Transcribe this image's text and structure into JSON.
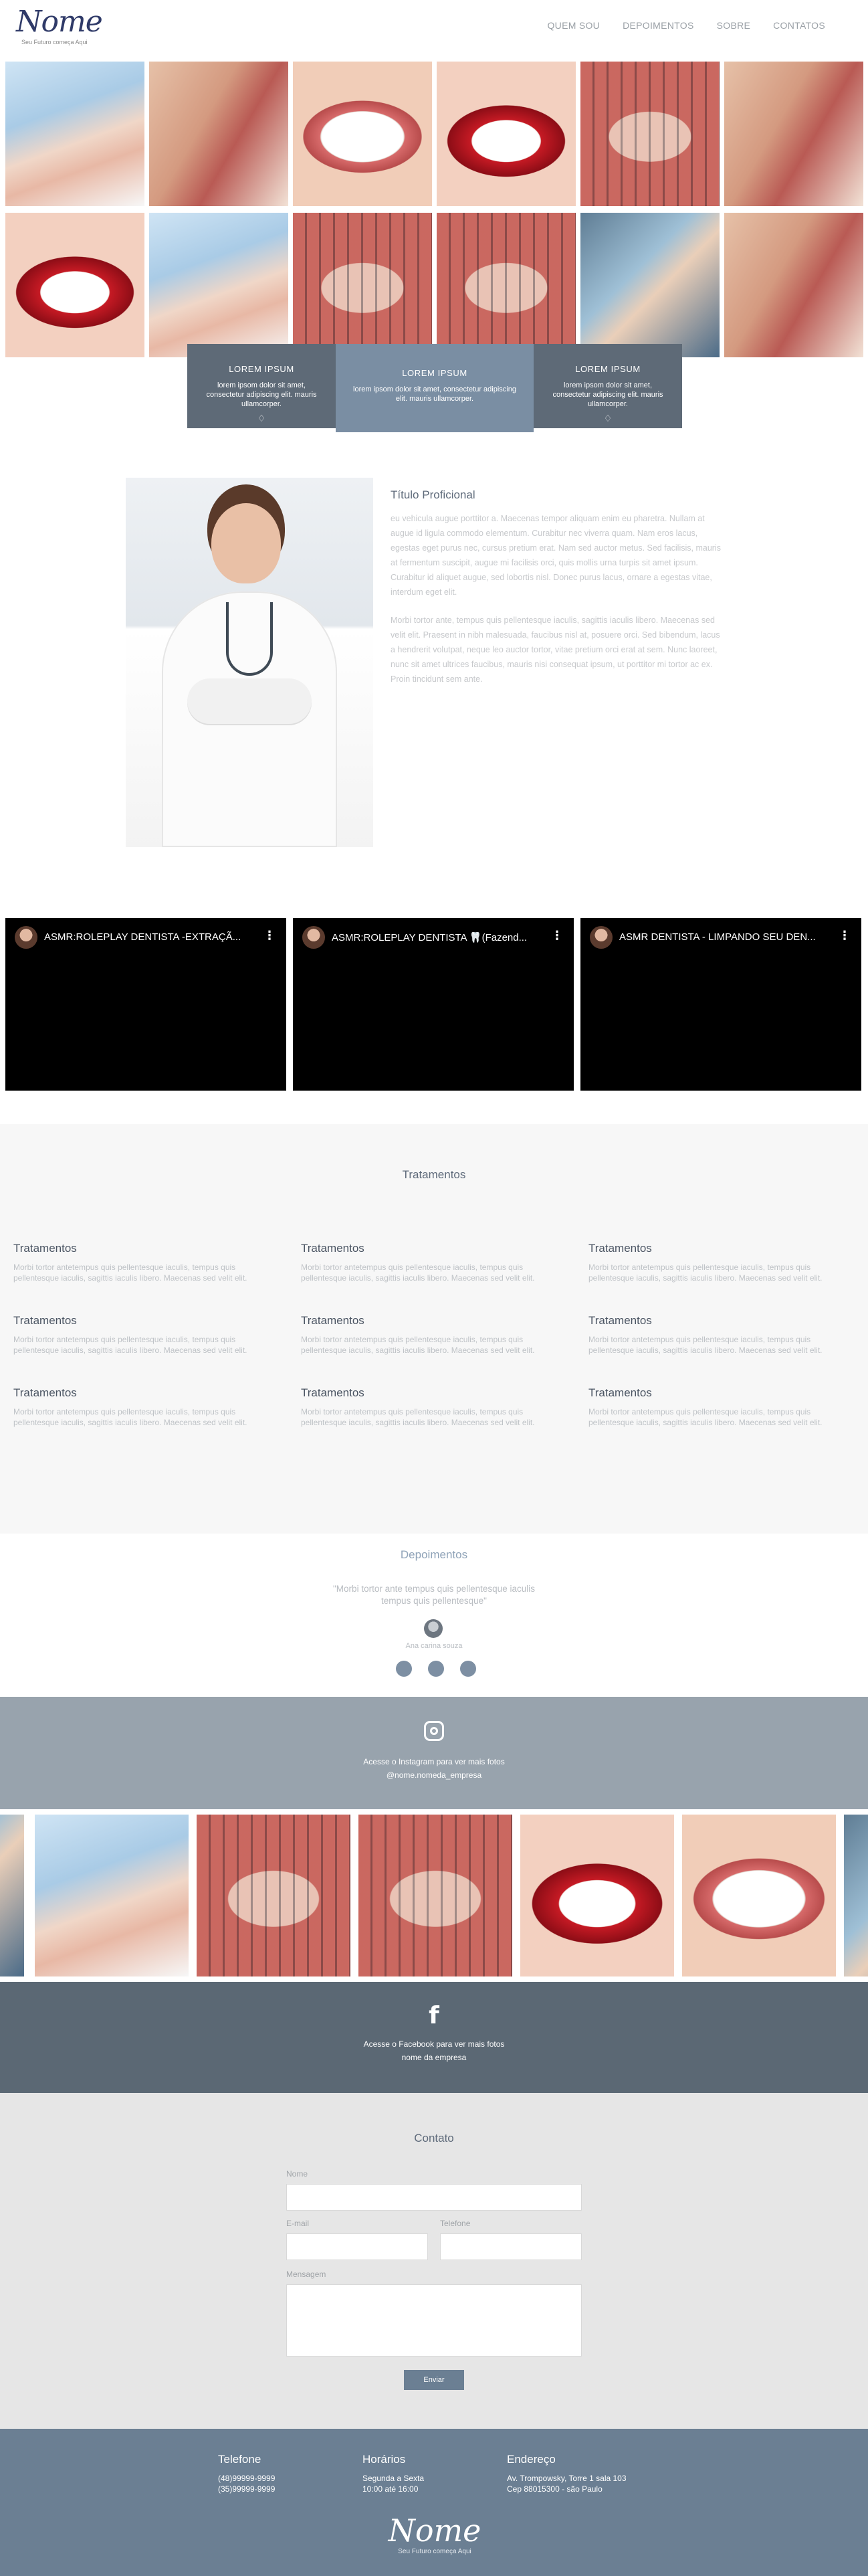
{
  "header": {
    "logo_text": "Nome",
    "logo_tagline": "Seu Futuro começa Aqui",
    "nav": [
      "QUEM SOU",
      "DEPOIMENTOS",
      "SOBRE",
      "CONTATOS"
    ]
  },
  "features": [
    {
      "title": "LOREM IPSUM",
      "text": "lorem ipsom dolor sit amet, consectetur adipiscing elit. mauris ullamcorper.",
      "icon": "tooth-icon"
    },
    {
      "title": "LOREM IPSUM",
      "text": "lorem ipsom dolor sit amet, consectetur adipiscing elit. mauris ullamcorper.",
      "icon": "none"
    },
    {
      "title": "LOREM IPSUM",
      "text": "lorem ipsom dolor sit amet, consectetur adipiscing elit. mauris ullamcorper.",
      "icon": "tooth-icon"
    }
  ],
  "about": {
    "title": "Título Proficional",
    "p1": "eu vehicula augue porttitor a. Maecenas tempor aliquam enim eu pharetra. Nullam at augue id ligula commodo elementum. Curabitur nec viverra quam. Nam eros lacus, egestas eget purus nec, cursus pretium erat. Nam sed auctor metus. Sed facilisis, mauris at fermentum suscipit, augue mi facilisis orci, quis mollis urna turpis sit amet ipsum. Curabitur id aliquet augue, sed lobortis nisl. Donec purus lacus, ornare a egestas vitae, interdum eget elit.",
    "p2": "Morbi tortor ante, tempus quis pellentesque iaculis, sagittis iaculis libero. Maecenas sed velit elit. Praesent in nibh malesuada, faucibus nisl at, posuere orci. Sed bibendum, lacus a hendrerit volutpat, neque leo auctor tortor, vitae pretium orci erat at sem. Nunc laoreet, nunc sit amet ultrices faucibus, mauris nisi consequat ipsum, ut porttitor mi tortor ac ex. Proin tincidunt sem ante."
  },
  "videos": [
    {
      "title": "ASMR:ROLEPLAY DENTISTA -EXTRAÇÃ...",
      "menu": "⋮"
    },
    {
      "title": "ASMR:ROLEPLAY DENTISTA 🦷(Fazend...",
      "menu": "⋮"
    },
    {
      "title": "ASMR DENTISTA - LIMPANDO SEU DEN...",
      "menu": "⋮"
    }
  ],
  "treatments": {
    "heading": "Tratamentos",
    "items": [
      {
        "title": "Tratamentos",
        "text": "Morbi tortor antetempus quis pellentesque iaculis, tempus quis pellentesque iaculis, sagittis iaculis libero. Maecenas sed velit elit."
      },
      {
        "title": "Tratamentos",
        "text": "Morbi tortor antetempus quis pellentesque iaculis, tempus quis pellentesque iaculis, sagittis iaculis libero. Maecenas sed velit elit."
      },
      {
        "title": "Tratamentos",
        "text": "Morbi tortor antetempus quis pellentesque iaculis, tempus quis pellentesque iaculis, sagittis iaculis libero. Maecenas sed velit elit."
      },
      {
        "title": "Tratamentos",
        "text": "Morbi tortor antetempus quis pellentesque iaculis, tempus quis pellentesque iaculis, sagittis iaculis libero. Maecenas sed velit elit."
      },
      {
        "title": "Tratamentos",
        "text": "Morbi tortor antetempus quis pellentesque iaculis, tempus quis pellentesque iaculis, sagittis iaculis libero. Maecenas sed velit elit."
      },
      {
        "title": "Tratamentos",
        "text": "Morbi tortor antetempus quis pellentesque iaculis, tempus quis pellentesque iaculis, sagittis iaculis libero. Maecenas sed velit elit."
      },
      {
        "title": "Tratamentos",
        "text": "Morbi tortor antetempus quis pellentesque iaculis, tempus quis pellentesque iaculis, sagittis iaculis libero. Maecenas sed velit elit."
      },
      {
        "title": "Tratamentos",
        "text": "Morbi tortor antetempus quis pellentesque iaculis, tempus quis pellentesque iaculis, sagittis iaculis libero. Maecenas sed velit elit."
      },
      {
        "title": "Tratamentos",
        "text": "Morbi tortor antetempus quis pellentesque iaculis, tempus quis pellentesque iaculis, sagittis iaculis libero. Maecenas sed velit elit."
      }
    ]
  },
  "testimonials": {
    "heading": "Depoimentos",
    "quote": "\"Morbi tortor ante tempus quis pellentesque iaculis tempus quis pellentesque\"",
    "author": "Ana carina souza"
  },
  "instagram": {
    "line1": "Acesse o Instagram para ver mais fotos",
    "line2": "@nome.nomeda_empresa"
  },
  "facebook": {
    "icon": "f",
    "line1": "Acesse o Facebook para ver mais fotos",
    "line2": "nome da empresa"
  },
  "contact": {
    "heading": "Contato",
    "name_label": "Nome",
    "email_label": "E-mail",
    "phone_label": "Telefone",
    "message_label": "Mensagem",
    "submit_label": "Enviar"
  },
  "footer": {
    "phone_title": "Telefone",
    "phone_1": "(48)99999-9999",
    "phone_2": "(35)99999-9999",
    "hours_title": "Horários",
    "hours_1": "Segunda a Sexta",
    "hours_2": "10:00 até 16:00",
    "address_title": "Endereço",
    "address_1": "Av. Trompowsky, Torre 1 sala 103",
    "address_2": "Cep 88015300 - são Paulo",
    "logo_text": "Nome",
    "logo_tagline": "Seu Futuro começa Aqui"
  },
  "colors": {
    "accent": "#6b7f93",
    "dark_band": "#5b6874",
    "light_band": "#98a3ad",
    "card": "#5e6a77",
    "card_highlight": "#7a8ea3"
  }
}
